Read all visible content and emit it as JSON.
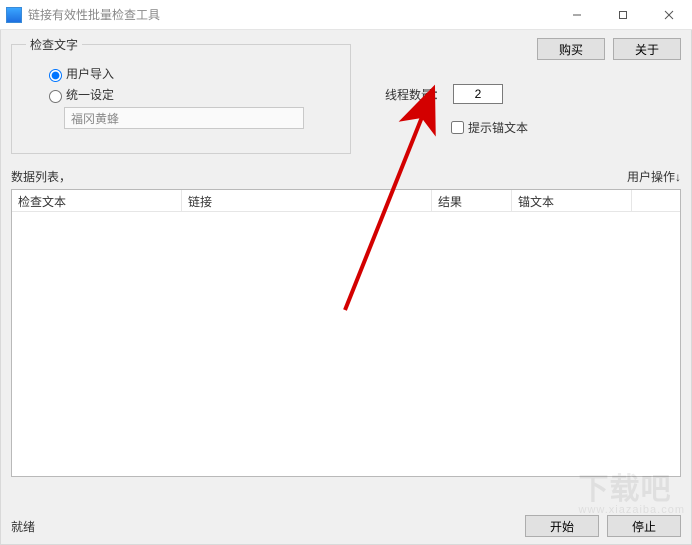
{
  "window": {
    "title": "链接有效性批量检查工具"
  },
  "buttons": {
    "buy": "购买",
    "about": "关于",
    "start": "开始",
    "stop": "停止"
  },
  "checktext": {
    "legend": "检查文字",
    "radio_user_import": "用户导入",
    "radio_fixed": "统一设定",
    "fixed_value": "福冈黄蜂",
    "selected": "user_import"
  },
  "thread": {
    "label": "线程数量：",
    "value": "2"
  },
  "anchor_checkbox": {
    "label": "提示锚文本",
    "checked": false
  },
  "list_labels": {
    "left": "数据列表，",
    "right": "用户操作↓"
  },
  "columns": {
    "c0": "检查文本",
    "c1": "链接",
    "c2": "结果",
    "c3": "锚文本",
    "c4": ""
  },
  "status": {
    "text": "就绪"
  },
  "watermark": {
    "main": "下载吧",
    "sub": "www.xiazaiba.com"
  }
}
